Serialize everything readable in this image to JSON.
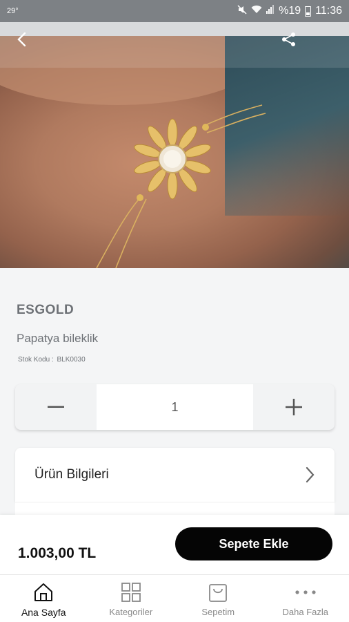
{
  "status_bar": {
    "temperature": "29°",
    "battery_text": "%19",
    "time": "11:36"
  },
  "header": {
    "back_icon": "chevron-left-icon",
    "share_icon": "share-icon"
  },
  "product": {
    "brand": "ESGOLD",
    "name": "Papatya bileklik",
    "stock_label": "Stok Kodu :",
    "stock_code": "BLK0030",
    "quantity": "1",
    "minus_label": "−",
    "plus_label": "+"
  },
  "info_card": {
    "title": "Ürün Bilgileri"
  },
  "footer": {
    "price": "1.003,00 TL",
    "add_to_cart": "Sepete Ekle"
  },
  "nav": {
    "items": [
      {
        "label": "Ana Sayfa",
        "icon": "home-icon",
        "active": true
      },
      {
        "label": "Kategoriler",
        "icon": "grid-icon",
        "active": false
      },
      {
        "label": "Sepetim",
        "icon": "shopping-bag-icon",
        "active": false
      },
      {
        "label": "Daha Fazla",
        "icon": "more-dots-icon",
        "active": false
      }
    ]
  },
  "colors": {
    "status_bar": "#7d8185",
    "button_dark": "#050505",
    "text_muted": "#6d7176"
  }
}
